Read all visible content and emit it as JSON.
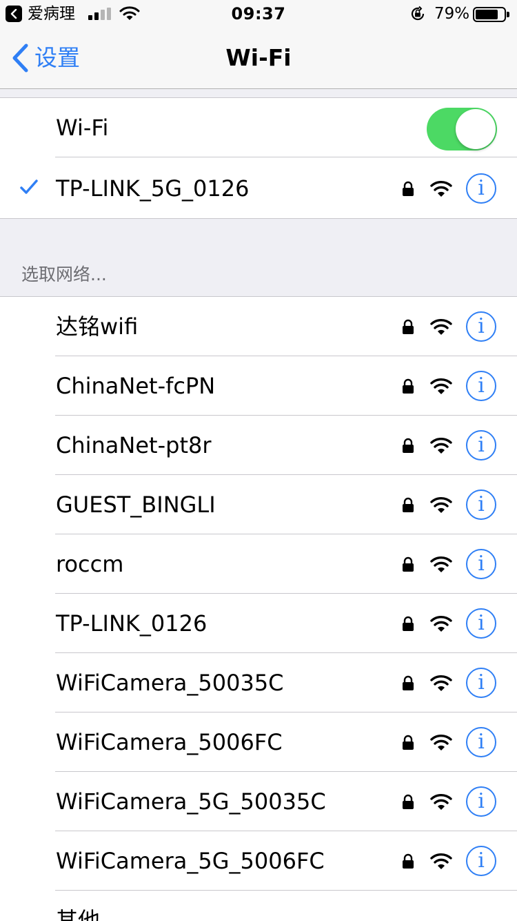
{
  "status_bar": {
    "back_app": "爱病理",
    "time": "09:37",
    "battery_percent": "79%",
    "battery_level": 0.79,
    "signal_bars": 4,
    "signal_bars_active": 2
  },
  "nav": {
    "back_label": "设置",
    "title": "Wi-Fi"
  },
  "wifi_toggle": {
    "label": "Wi-Fi",
    "on": true
  },
  "connected_network": {
    "name": "TP-LINK_5G_0126",
    "secured": true,
    "icons": [
      "checkmark-icon",
      "lock-icon",
      "wifi-signal-icon",
      "info-icon"
    ]
  },
  "choose_network": {
    "header": "选取网络...",
    "networks": [
      {
        "name": "达铭wifi"
      },
      {
        "name": "ChinaNet-fcPN"
      },
      {
        "name": "ChinaNet-pt8r"
      },
      {
        "name": "GUEST_BINGLI"
      },
      {
        "name": "roccm"
      },
      {
        "name": "TP-LINK_0126"
      },
      {
        "name": "WiFiCamera_50035C"
      },
      {
        "name": "WiFiCamera_5006FC"
      },
      {
        "name": "WiFiCamera_5G_50035C"
      },
      {
        "name": "WiFiCamera_5G_5006FC"
      }
    ],
    "other_label": "其他..."
  },
  "info_glyph": "i",
  "colors": {
    "accent": "#2f7ff5",
    "toggle_on": "#4cd964",
    "background": "#efeff4"
  }
}
